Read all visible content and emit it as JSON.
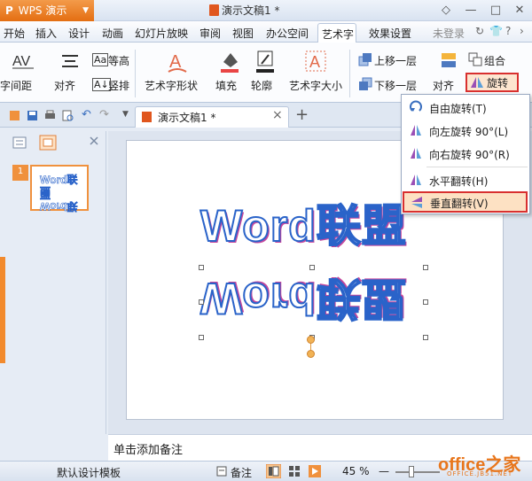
{
  "app": {
    "name": "WPS 演示",
    "logo": "P",
    "dropdown_arrow": "▼"
  },
  "window": {
    "title": "演示文稿1 *",
    "buttons": [
      "◇",
      "—",
      "□",
      "✕"
    ]
  },
  "menu": {
    "items": [
      "开始",
      "插入",
      "设计",
      "动画",
      "幻灯片放映",
      "审阅",
      "视图",
      "办公空间",
      "艺术字",
      "效果设置"
    ],
    "active": "艺术字",
    "login": "未登录",
    "help": "?",
    "extra_icons": [
      "↻",
      "👕",
      "›"
    ]
  },
  "ribbon": {
    "spacing": "字间距",
    "align": "对齐",
    "equal_height": "等高",
    "vertical": "竖排",
    "shape": "艺术字形状",
    "fill": "填充",
    "outline": "轮廓",
    "size": "艺术字大小",
    "bring_forward": "上移一层",
    "send_backward": "下移一层",
    "align2": "对齐",
    "group": "组合",
    "rotate": "旋转"
  },
  "tabs": {
    "doc": "演示文稿1 *",
    "close": "×",
    "add": "+"
  },
  "dropdown": {
    "items": [
      "自由旋转(T)",
      "向左旋转 90°(L)",
      "向右旋转 90°(R)",
      "水平翻转(H)",
      "垂直翻转(V)"
    ],
    "highlighted": "垂直翻转(V)"
  },
  "slide": {
    "number": "1",
    "art_text": "Word联盟"
  },
  "notes": {
    "placeholder": "单击添加备注"
  },
  "status": {
    "template": "默认设计模板",
    "notes": "备注",
    "zoom": "45 %",
    "minus": "—"
  },
  "watermark": {
    "main": "office之家",
    "sub": "OFFICE.JB51.NET"
  },
  "colors": {
    "accent_orange": "#e8761c",
    "highlight_red": "#d8302f",
    "art_blue": "#2a63c9"
  }
}
